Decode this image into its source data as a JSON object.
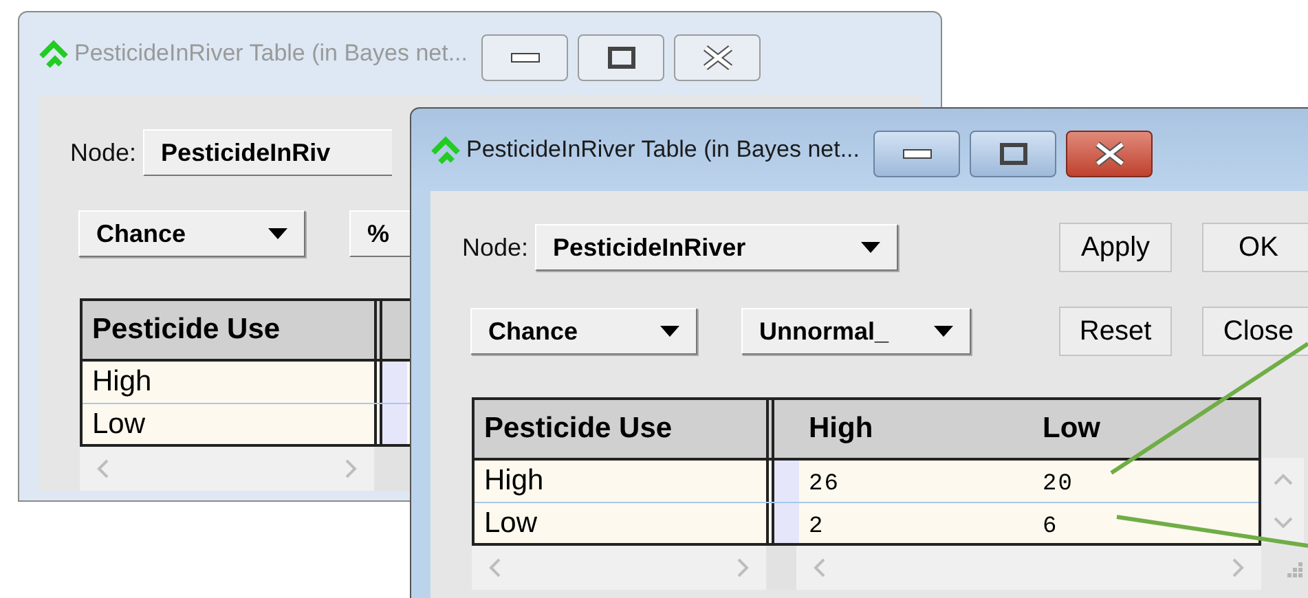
{
  "windows": [
    {
      "title": "PesticideInRiver Table (in Bayes net...",
      "active": false,
      "node_label": "Node:",
      "node": {
        "text": "PesticideInRiv",
        "clipped": true
      },
      "type": {
        "text": "Chance",
        "clipped": false
      },
      "format": {
        "text": "%",
        "clipped": true
      },
      "table": {
        "columns": [
          "Pesticide Use"
        ],
        "rows": [
          {
            "label": "High"
          },
          {
            "label": "Low"
          }
        ]
      }
    },
    {
      "title": "PesticideInRiver Table (in Bayes net...",
      "active": true,
      "node_label": "Node:",
      "node": {
        "text": "PesticideInRiver",
        "clipped": false
      },
      "type": {
        "text": "Chance",
        "clipped": false
      },
      "format": {
        "text": "Unnormal_",
        "clipped": false
      },
      "buttons": [
        "Apply",
        "OK",
        "Reset",
        "Close"
      ],
      "table": {
        "columns": [
          "Pesticide Use",
          "High",
          "Low"
        ],
        "rows": [
          {
            "label": "High",
            "values": [
              "26",
              "20"
            ]
          },
          {
            "label": "Low",
            "values": [
              "2",
              "6"
            ]
          }
        ]
      }
    }
  ]
}
